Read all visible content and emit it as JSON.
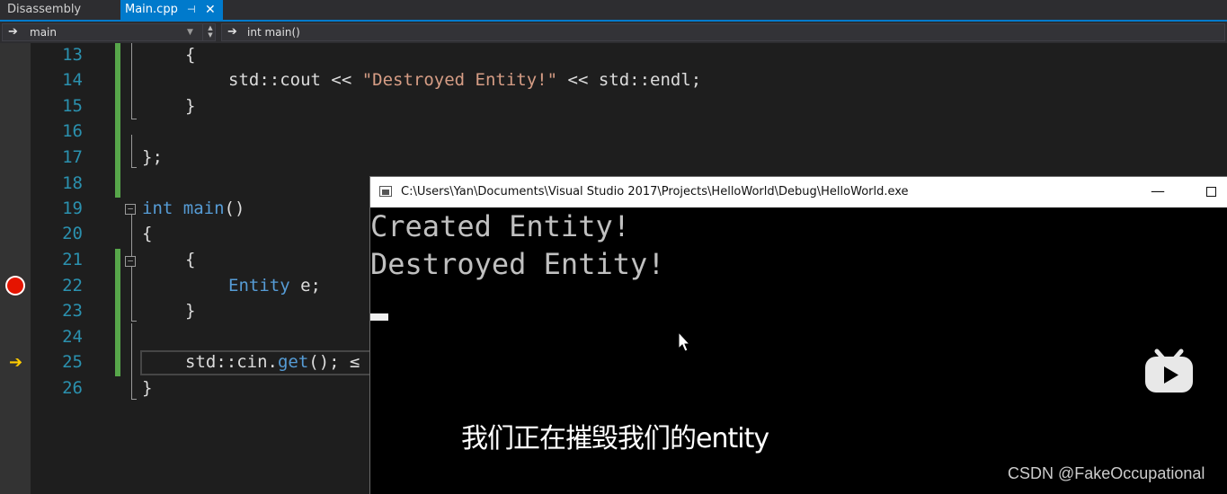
{
  "tabs": {
    "disassembly": "Disassembly",
    "main_cpp": "Main.cpp",
    "pin_glyph": "⊣",
    "close_glyph": "✕"
  },
  "navbar": {
    "scope": "main",
    "function": "int main()"
  },
  "editor": {
    "line_numbers": [
      "13",
      "14",
      "15",
      "16",
      "17",
      "18",
      "19",
      "20",
      "21",
      "22",
      "23",
      "24",
      "25",
      "26"
    ],
    "code": {
      "l13": "{",
      "l14_a": "std::cout << ",
      "l14_str": "\"Destroyed Entity!\"",
      "l14_b": " << std::endl;",
      "l15": "}",
      "l17": "};",
      "l19_kw": "int",
      "l19_fn": "main",
      "l19_rest": "()",
      "l20": "{",
      "l21": "{",
      "l22_type": "Entity",
      "l22_rest": " e;",
      "l23": "}",
      "l25_a": "std::cin.",
      "l25_fn": "get",
      "l25_b": "(); ≤",
      "l26": "}"
    },
    "icons": {
      "breakpoint": "breakpoint-icon",
      "current_statement": "execution-arrow-icon"
    }
  },
  "console": {
    "title": "C:\\Users\\Yan\\Documents\\Visual Studio 2017\\Projects\\HelloWorld\\Debug\\HelloWorld.exe",
    "minimize_glyph": "—",
    "lines": [
      "Created Entity!",
      "Destroyed Entity!"
    ]
  },
  "overlay": {
    "subtitle": "我们正在摧毁我们的entity",
    "watermark": "CSDN @FakeOccupational"
  },
  "colors": {
    "accent": "#007acc",
    "line_number": "#2b91af",
    "keyword": "#569cd6",
    "string": "#d69d85",
    "type": "#4ec9b0",
    "breakpoint": "#e51400",
    "change_bar": "#57a64a"
  }
}
